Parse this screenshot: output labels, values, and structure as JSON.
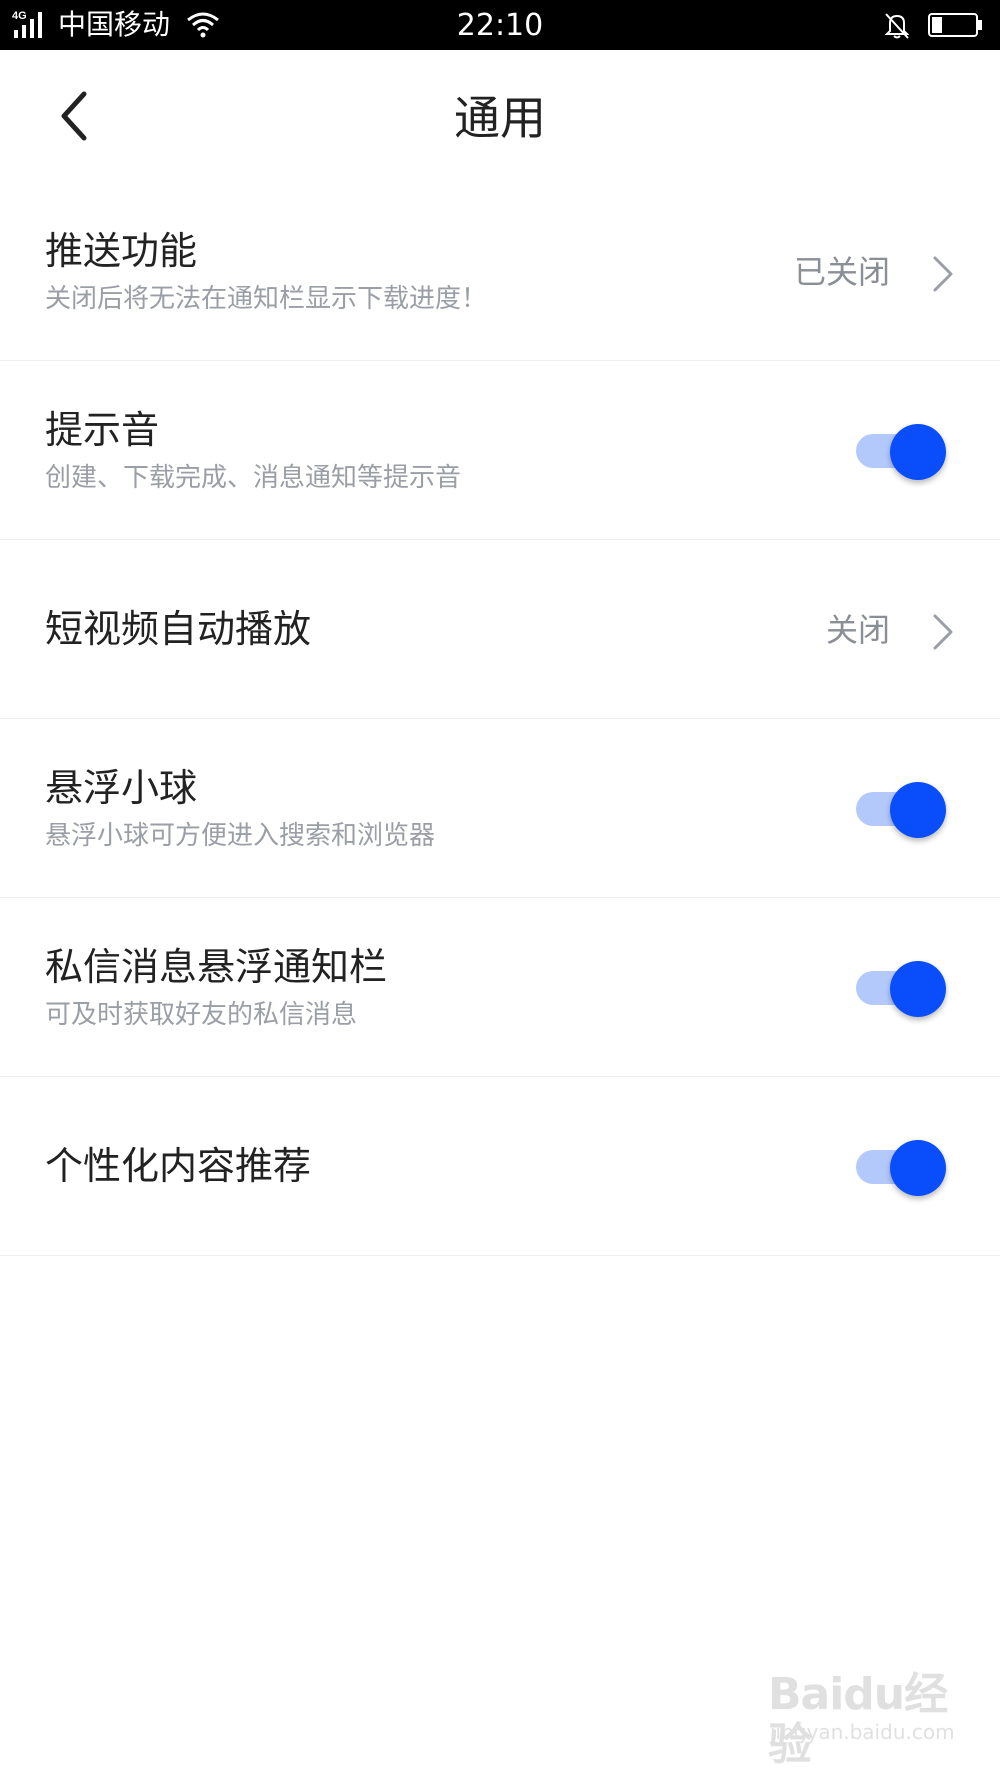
{
  "status_bar": {
    "network": "4G",
    "carrier": "中国移动",
    "time": "22:10",
    "icons": [
      "signal-icon",
      "wifi-icon",
      "bell-muted-icon",
      "battery-icon"
    ]
  },
  "header": {
    "title": "通用",
    "back_icon": "chevron-left-icon"
  },
  "settings": [
    {
      "title": "推送功能",
      "subtitle": "关闭后将无法在通知栏显示下载进度！",
      "value": "已关闭",
      "type": "link"
    },
    {
      "title": "提示音",
      "subtitle": "创建、下载完成、消息通知等提示音",
      "type": "toggle",
      "on": true
    },
    {
      "title": "短视频自动播放",
      "value": "关闭",
      "type": "link"
    },
    {
      "title": "悬浮小球",
      "subtitle": "悬浮小球可方便进入搜索和浏览器",
      "type": "toggle",
      "on": true
    },
    {
      "title": "私信消息悬浮通知栏",
      "subtitle": "可及时获取好友的私信消息",
      "type": "toggle",
      "on": true
    },
    {
      "title": "个性化内容推荐",
      "type": "toggle",
      "on": true
    }
  ],
  "colors": {
    "accent": "#0a4dfb",
    "toggle_track": "#b4c9fb",
    "status_bar_bg": "#000000"
  },
  "watermark": {
    "brand": "Baidu经验",
    "url": "jingyan.baidu.com"
  }
}
